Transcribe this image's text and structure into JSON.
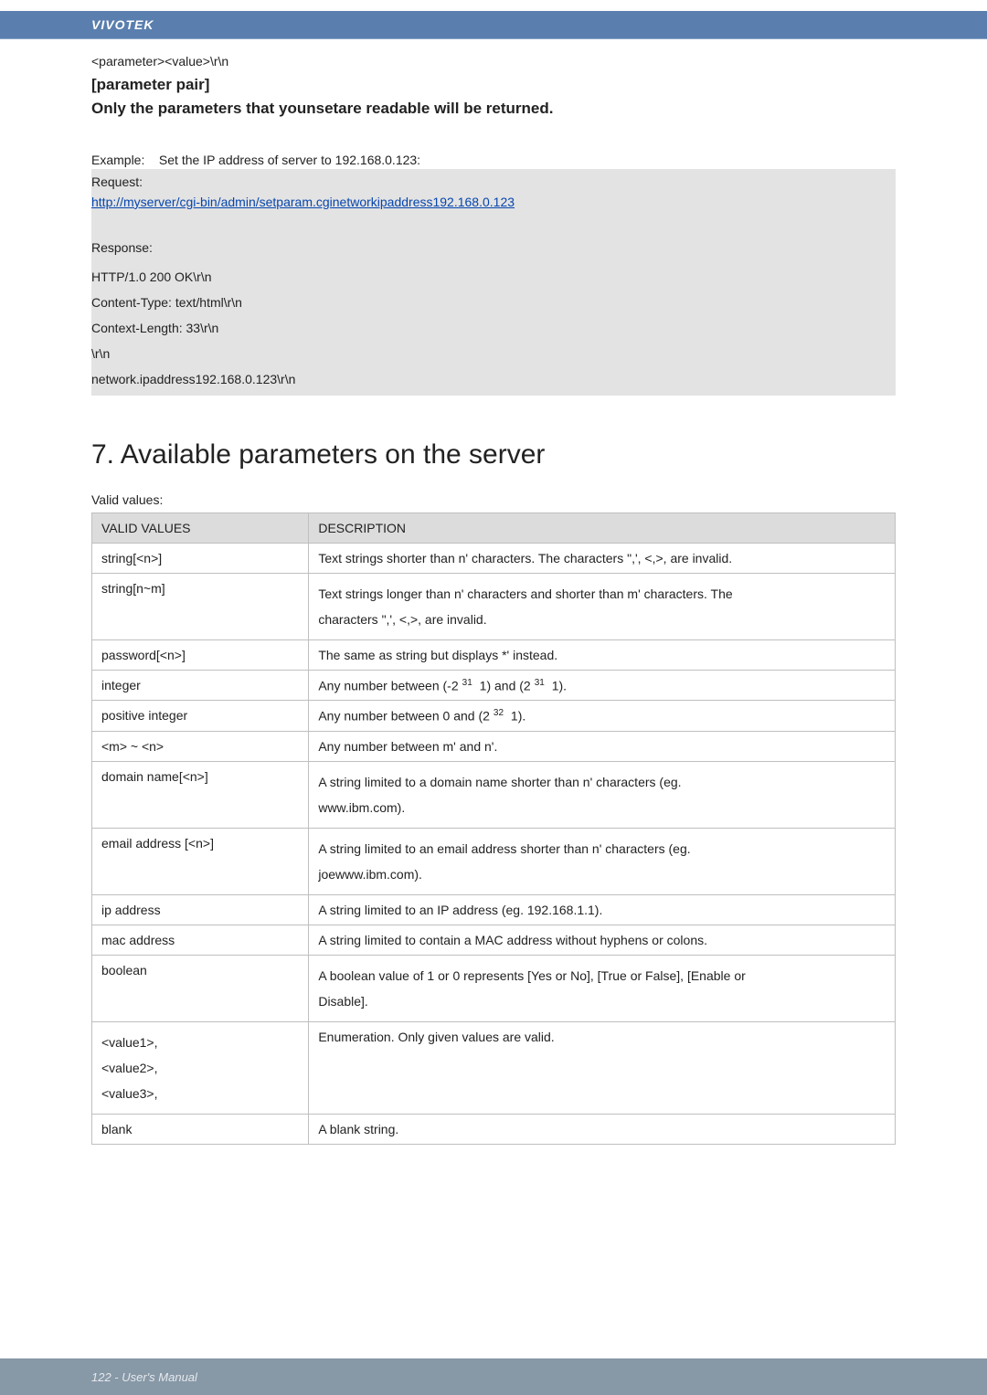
{
  "brand": "VIVOTEK",
  "body": {
    "param_value_line": "<parameter><value>\\r\\n",
    "pair_heading": "[parameter pair]",
    "only_line": "Only the parameters that younsetare readable will be returned.",
    "example_label": "Example:",
    "example_text": "Set the IP address of server to 192.168.0.123:",
    "request_label": "Request:",
    "request_url": "http://myserver/cgi-bin/admin/setparam.cginetworkipaddress192.168.0.123",
    "response_label": "Response:",
    "resp_lines": [
      "HTTP/1.0 200 OK\\r\\n",
      "Content-Type: text/html\\r\\n",
      "Context-Length: 33\\r\\n",
      "\\r\\n",
      "network.ipaddress192.168.0.123\\r\\n"
    ],
    "section_title": "7. Available parameters on the server",
    "valid_values_label": "Valid values:",
    "table_headers": {
      "col1": "VALID VALUES",
      "col2": "DESCRIPTION"
    },
    "table": [
      {
        "v": "string[<n>]",
        "d": "Text strings shorter than n' characters. The characters \",', <,>, are invalid."
      },
      {
        "v": "string[n~m]",
        "d": "Text strings longer than n' characters and shorter than m' characters. The\ncharacters \",', <,>, are invalid."
      },
      {
        "v": "password[<n>]",
        "d": "The same as string but displays *' instead."
      },
      {
        "v": "integer",
        "d_pre": "Any number between (-2",
        "sup1": "31",
        "d_mid": "  1) and (2",
        "sup2": "31",
        "d_post": "  1)."
      },
      {
        "v": "positive integer",
        "d_pre": "Any number between 0 and (2",
        "sup1": "32",
        "d_post": "  1)."
      },
      {
        "v": "<m> ~ <n>",
        "d": "Any number between m' and n'."
      },
      {
        "v": "domain name[<n>]",
        "d": "A string limited to a domain name shorter than n' characters (eg.\nwww.ibm.com)."
      },
      {
        "v": "email address [<n>]",
        "d": "A string limited to an email address shorter than n' characters (eg.\njoewww.ibm.com)."
      },
      {
        "v": "ip address",
        "d": "A string limited to an IP address (eg. 192.168.1.1)."
      },
      {
        "v": "mac address",
        "d": "A string limited to contain a MAC address without hyphens or colons."
      },
      {
        "v": "boolean",
        "d": "A boolean value of 1 or 0 represents [Yes or No], [True or False], [Enable or\nDisable]."
      },
      {
        "v": "<value1>,\n<value2>,\n<value3>,\n",
        "d": "Enumeration. Only given values are valid."
      },
      {
        "v": "blank",
        "d": "A blank string."
      }
    ]
  },
  "footer": "122 - User's Manual"
}
